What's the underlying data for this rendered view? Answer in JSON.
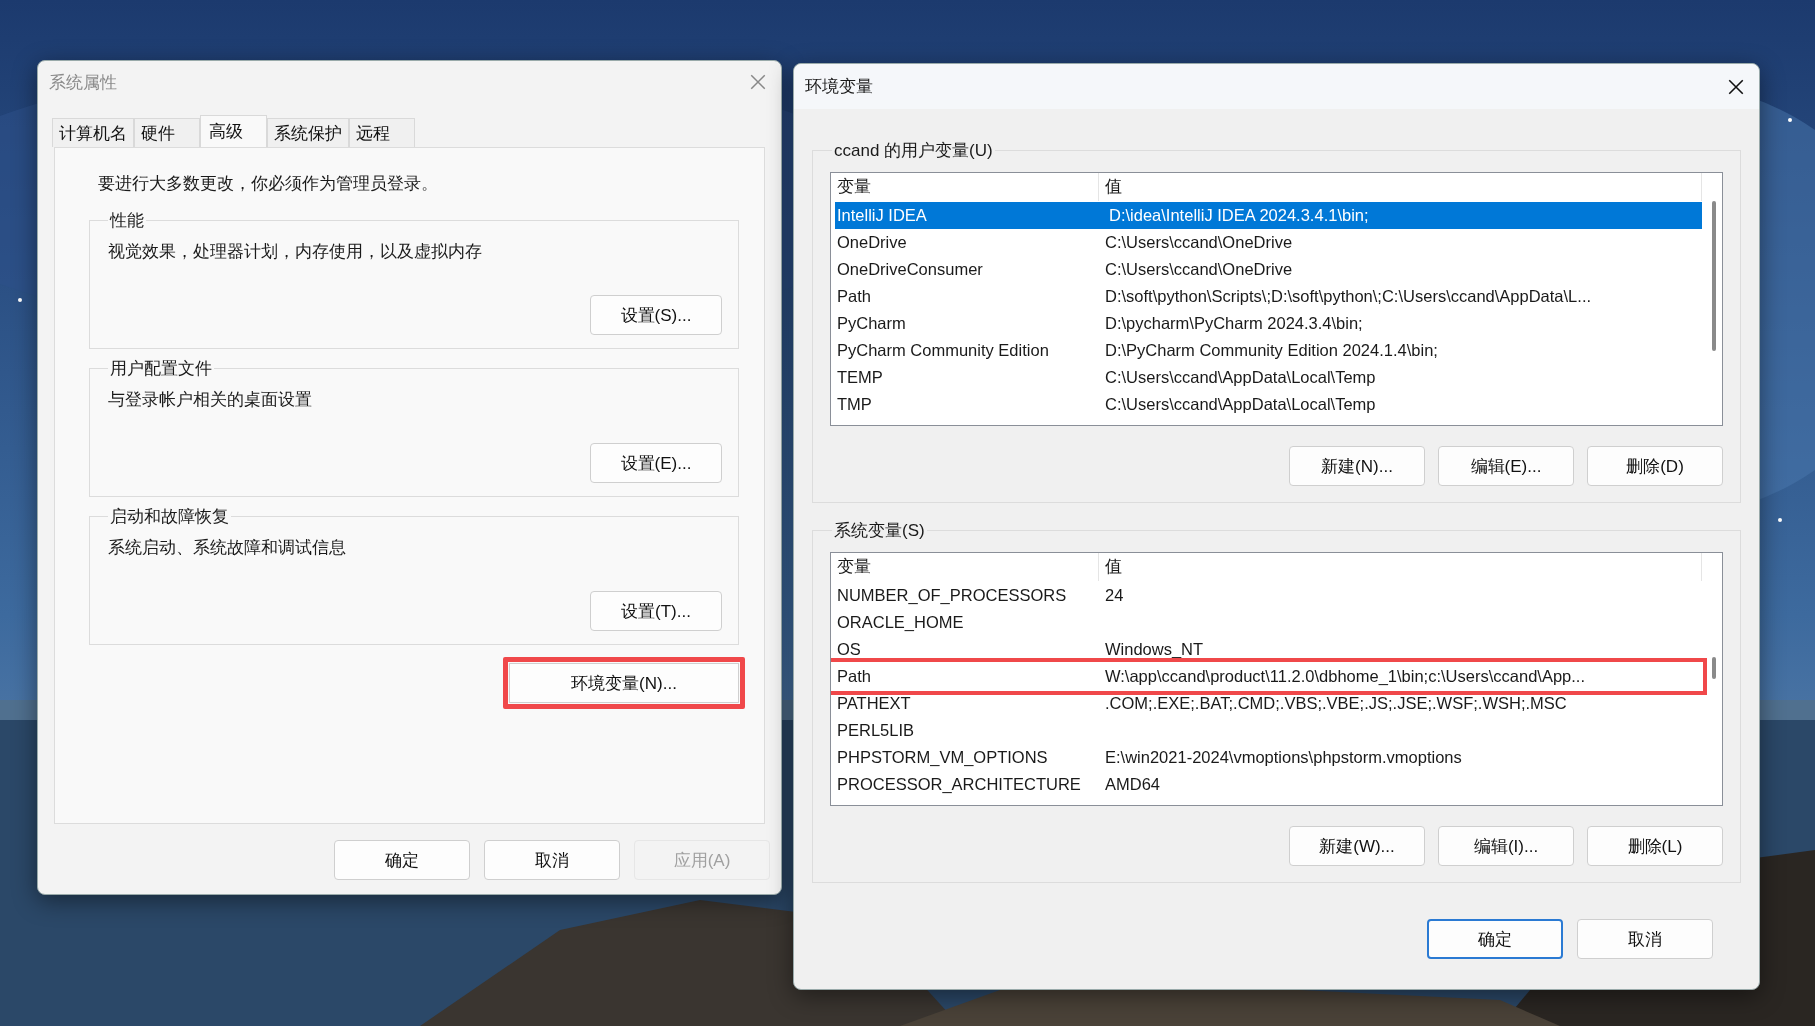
{
  "system_properties": {
    "title": "系统属性",
    "tabs": [
      {
        "label": "计算机名",
        "selected": false
      },
      {
        "label": "硬件",
        "selected": false
      },
      {
        "label": "高级",
        "selected": true
      },
      {
        "label": "系统保护",
        "selected": false
      },
      {
        "label": "远程",
        "selected": false
      }
    ],
    "admin_note": "要进行大多数更改，你必须作为管理员登录。",
    "groups": [
      {
        "title": "性能",
        "description": "视觉效果，处理器计划，内存使用，以及虚拟内存",
        "button": "设置(S)..."
      },
      {
        "title": "用户配置文件",
        "description": "与登录帐户相关的桌面设置",
        "button": "设置(E)..."
      },
      {
        "title": "启动和故障恢复",
        "description": "系统启动、系统故障和调试信息",
        "button": "设置(T)..."
      }
    ],
    "env_button": {
      "label": "环境变量(N)...",
      "highlighted": true
    },
    "buttons": [
      {
        "label": "确定",
        "disabled": false
      },
      {
        "label": "取消",
        "disabled": false
      },
      {
        "label": "应用(A)",
        "disabled": true
      }
    ]
  },
  "environment_variables": {
    "title": "环境变量",
    "sections": [
      {
        "title": "ccand 的用户变量(U)",
        "columns": [
          "变量",
          "值"
        ],
        "rows": [
          {
            "name": "IntelliJ IDEA",
            "value": "D:\\idea\\IntelliJ IDEA 2024.3.4.1\\bin;",
            "selected": true,
            "highlighted": false
          },
          {
            "name": "OneDrive",
            "value": "C:\\Users\\ccand\\OneDrive",
            "selected": false,
            "highlighted": false
          },
          {
            "name": "OneDriveConsumer",
            "value": "C:\\Users\\ccand\\OneDrive",
            "selected": false,
            "highlighted": false
          },
          {
            "name": "Path",
            "value": "D:\\soft\\python\\Scripts\\;D:\\soft\\python\\;C:\\Users\\ccand\\AppData\\L...",
            "selected": false,
            "highlighted": false
          },
          {
            "name": "PyCharm",
            "value": "D:\\pycharm\\PyCharm 2024.3.4\\bin;",
            "selected": false,
            "highlighted": false
          },
          {
            "name": "PyCharm Community Edition",
            "value": "D:\\PyCharm Community Edition 2024.1.4\\bin;",
            "selected": false,
            "highlighted": false
          },
          {
            "name": "TEMP",
            "value": "C:\\Users\\ccand\\AppData\\Local\\Temp",
            "selected": false,
            "highlighted": false
          },
          {
            "name": "TMP",
            "value": "C:\\Users\\ccand\\AppData\\Local\\Temp",
            "selected": false,
            "highlighted": false
          }
        ],
        "buttons": [
          "新建(N)...",
          "编辑(E)...",
          "删除(D)"
        ]
      },
      {
        "title": "系统变量(S)",
        "columns": [
          "变量",
          "值"
        ],
        "rows": [
          {
            "name": "NUMBER_OF_PROCESSORS",
            "value": "24",
            "selected": false,
            "highlighted": false
          },
          {
            "name": "ORACLE_HOME",
            "selected": false,
            "highlighted": false
          },
          {
            "name": "OS",
            "value": "Windows_NT",
            "selected": false,
            "highlighted": false
          },
          {
            "name": "Path",
            "value": "W:\\app\\ccand\\product\\11.2.0\\dbhome_1\\bin;c:\\Users\\ccand\\App...",
            "selected": false,
            "highlighted": true
          },
          {
            "name": "PATHEXT",
            "value": ".COM;.EXE;.BAT;.CMD;.VBS;.VBE;.JS;.JSE;.WSF;.WSH;.MSC",
            "selected": false,
            "highlighted": false
          },
          {
            "name": "PERL5LIB",
            "selected": false,
            "highlighted": false
          },
          {
            "name": "PHPSTORM_VM_OPTIONS",
            "value": "E:\\win2021-2024\\vmoptions\\phpstorm.vmoptions",
            "selected": false,
            "highlighted": false
          },
          {
            "name": "PROCESSOR_ARCHITECTURE",
            "value": "AMD64",
            "selected": false,
            "highlighted": false
          }
        ],
        "buttons": [
          "新建(W)...",
          "编辑(I)...",
          "删除(L)"
        ]
      }
    ],
    "buttons": [
      {
        "label": "确定",
        "default": true
      },
      {
        "label": "取消",
        "default": false
      }
    ]
  }
}
